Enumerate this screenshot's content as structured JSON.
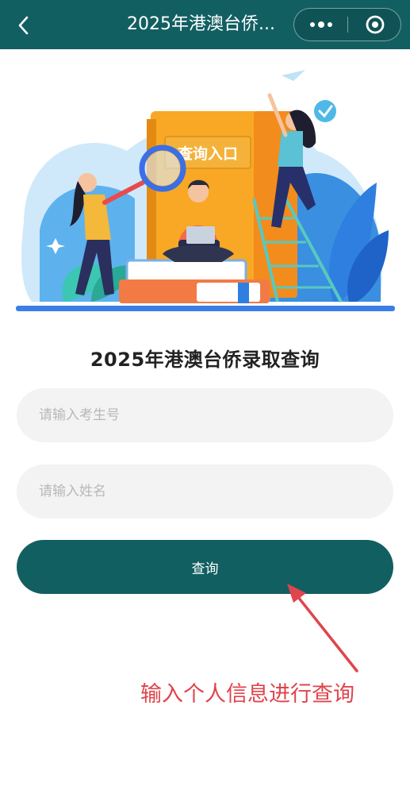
{
  "navbar": {
    "title": "2025年港澳台侨...",
    "back_icon": "chevron-left-icon",
    "more_icon": "more-dots-icon",
    "close_icon": "target-close-icon",
    "color": "#125f62"
  },
  "hero": {
    "sign_text": "查询入口"
  },
  "form": {
    "title": "2025年港澳台侨录取查询",
    "exam_no_placeholder": "请输入考生号",
    "exam_no_value": "",
    "name_placeholder": "请输入姓名",
    "name_value": "",
    "query_label": "查询"
  },
  "annotation": {
    "text": "输入个人信息进行查询",
    "color": "#e0444c"
  }
}
